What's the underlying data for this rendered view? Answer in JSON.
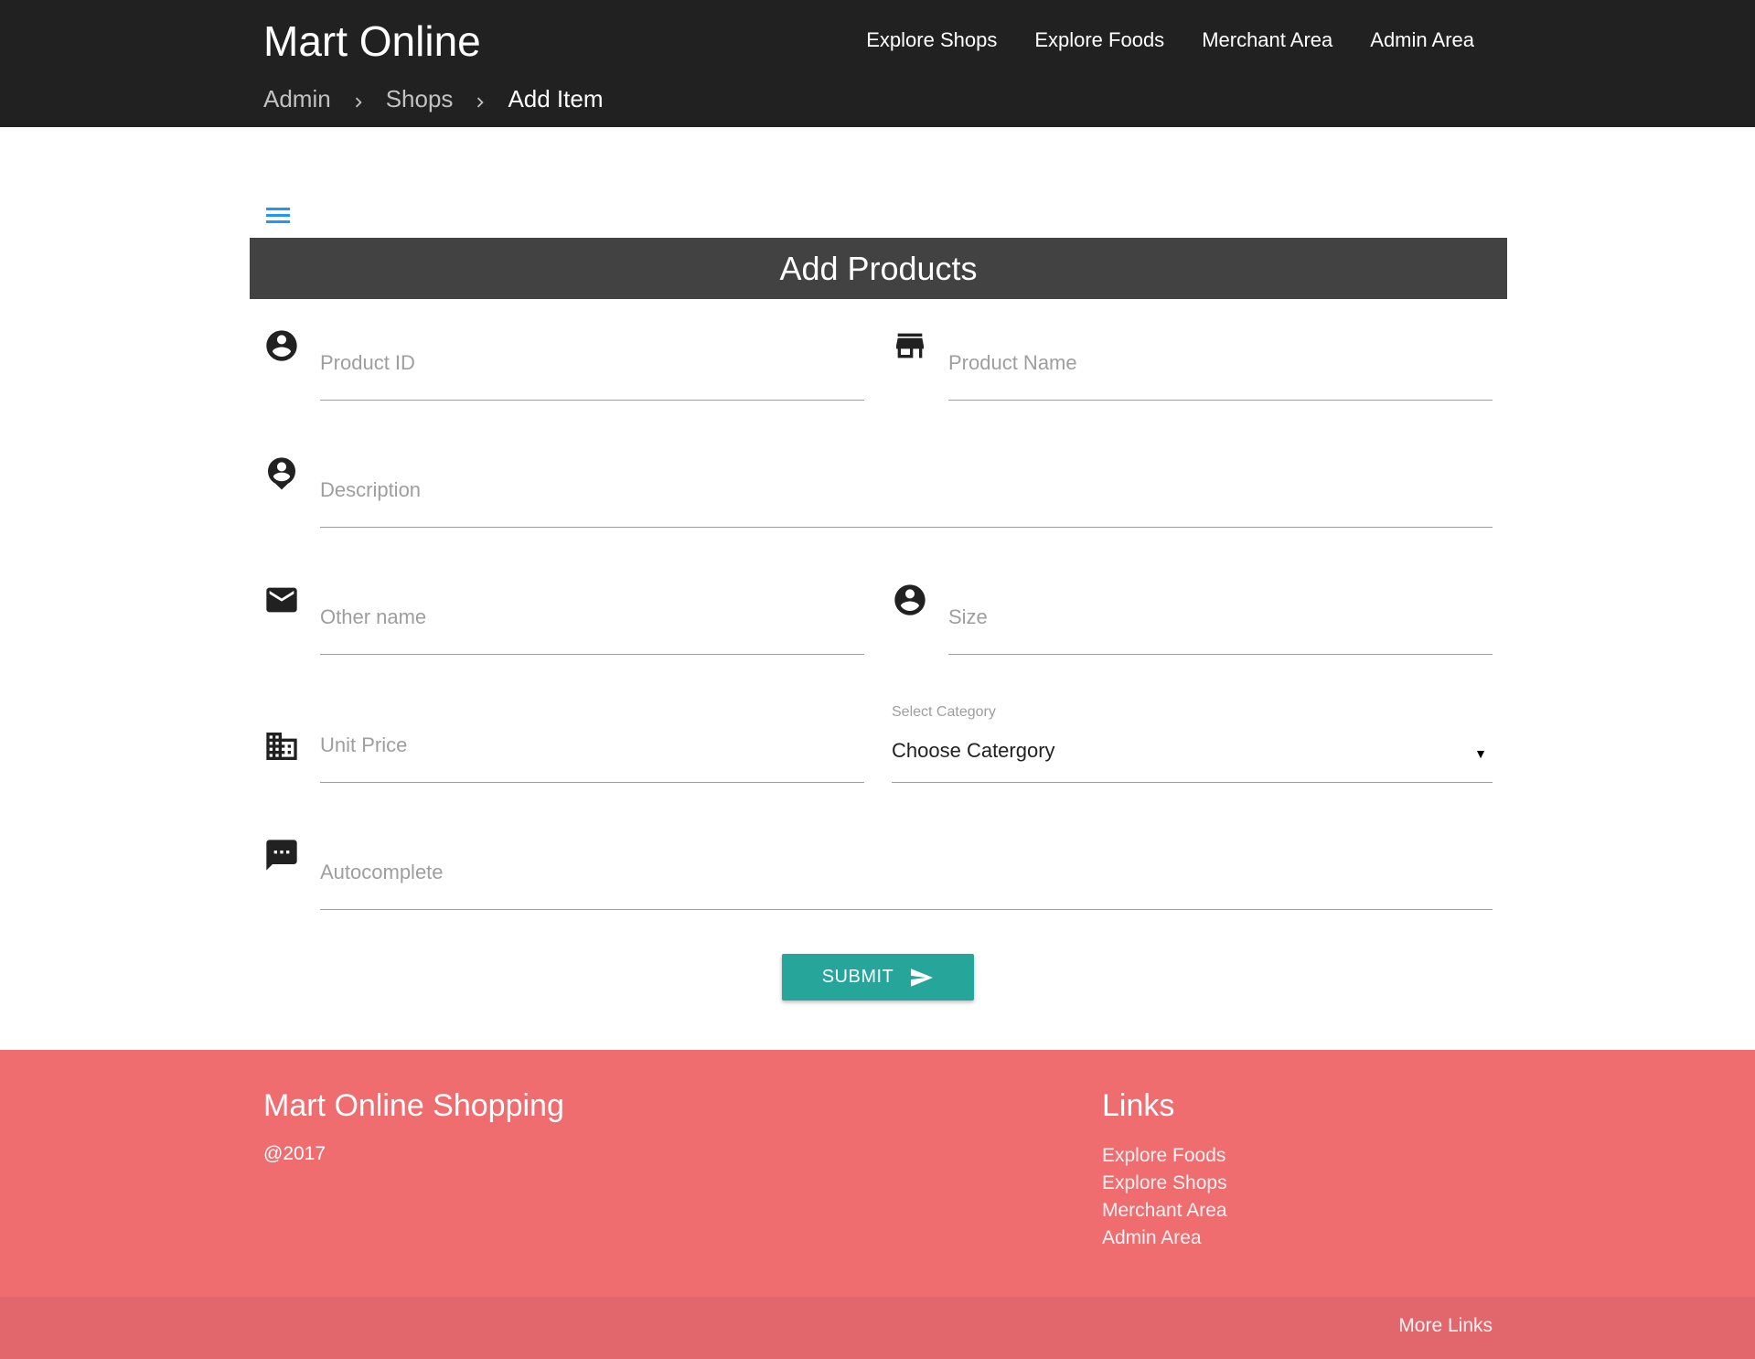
{
  "header": {
    "brand": "Mart Online",
    "nav": [
      "Explore Shops",
      "Explore Foods",
      "Merchant Area",
      "Admin Area"
    ],
    "breadcrumb": [
      "Admin",
      "Shops",
      "Add Item"
    ]
  },
  "form": {
    "title": "Add Products",
    "fields": {
      "product_id": {
        "placeholder": "Product ID",
        "icon": "account-circle-icon"
      },
      "product_name": {
        "placeholder": "Product Name",
        "icon": "store-icon"
      },
      "description": {
        "placeholder": "Description",
        "icon": "account-pin-icon"
      },
      "other_name": {
        "placeholder": "Other name",
        "icon": "email-icon"
      },
      "size": {
        "placeholder": "Size",
        "icon": "account-circle-icon"
      },
      "unit_price": {
        "placeholder": "Unit Price",
        "icon": "business-icon"
      },
      "autocomplete": {
        "placeholder": "Autocomplete",
        "icon": "chat-bubble-icon"
      }
    },
    "category": {
      "label": "Select Category",
      "selected": "Choose Catergory"
    },
    "submit_label": "SUBMIT"
  },
  "footer": {
    "title": "Mart Online Shopping",
    "year": "@2017",
    "links_title": "Links",
    "links": [
      "Explore Foods",
      "Explore Shops",
      "Merchant Area",
      "Admin Area"
    ],
    "more_links": "More Links"
  },
  "colors": {
    "header_bg": "#212121",
    "title_bar_bg": "#424242",
    "accent_teal": "#26a69a",
    "menu_icon_blue": "#2196f3",
    "footer_bg": "#ef6c6f",
    "footer_bottom_bg": "#e1676d"
  }
}
